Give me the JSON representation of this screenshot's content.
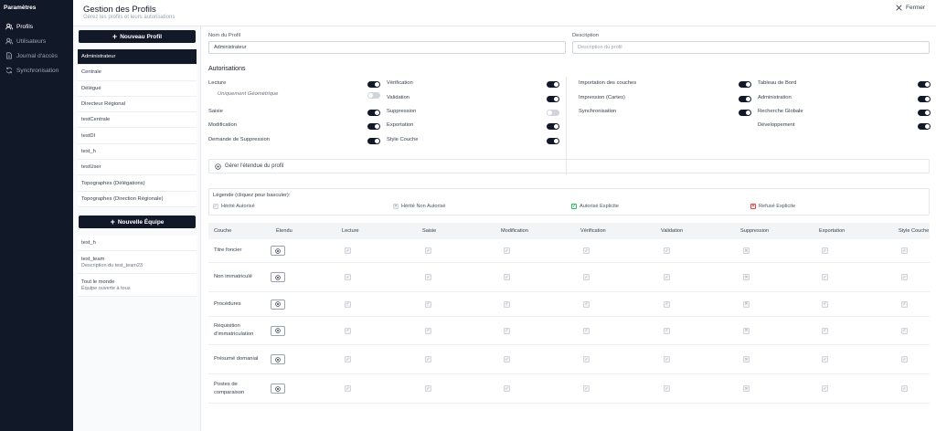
{
  "nav": {
    "title": "Paramètres",
    "items": [
      {
        "label": "Profils",
        "icon": "users-icon",
        "active": true
      },
      {
        "label": "Utilisateurs",
        "icon": "users-icon",
        "active": false
      },
      {
        "label": "Journal d'accès",
        "icon": "document-icon",
        "active": false
      },
      {
        "label": "Synchronisation",
        "icon": "sync-icon",
        "active": false
      }
    ]
  },
  "header": {
    "title": "Gestion des Profils",
    "subtitle": "Gérez les profils et leurs autorisations",
    "close_label": "Fermer"
  },
  "sidebar": {
    "new_profile_label": "Nouveau Profil",
    "profiles": [
      "Administrateur",
      "Centrale",
      "Délégué",
      "Directeur Régional",
      "testCentrale",
      "testDI",
      "test_h",
      "testUser",
      "Topographes (Délégations)",
      "Topographes (Direction Régionale)"
    ],
    "new_team_label": "Nouvelle Équipe",
    "teams": [
      {
        "name": "test_h",
        "description": ""
      },
      {
        "name": "test_team",
        "description": "Description du test_team23"
      },
      {
        "name": "Tout le monde",
        "description": "Équipe ouverte à tous"
      }
    ]
  },
  "form": {
    "profile_name_label": "Nom du Profil",
    "profile_name_value": "Administrateur",
    "description_label": "Description",
    "description_placeholder": "Description du profil"
  },
  "autorisations": {
    "title": "Autorisations",
    "col1": [
      {
        "label": "Lecture",
        "on": true
      },
      {
        "label": "Uniquement Géométrique",
        "on": false,
        "sub": true
      },
      {
        "label": "Saisie",
        "on": true
      },
      {
        "label": "Modification",
        "on": true
      },
      {
        "label": "Demande de Suppression",
        "on": true
      }
    ],
    "col2": [
      {
        "label": "Vérification",
        "on": true
      },
      {
        "label": "Validation",
        "on": true
      },
      {
        "label": "Suppression",
        "on": false
      },
      {
        "label": "Exportation",
        "on": true
      },
      {
        "label": "Style Couche",
        "on": true
      }
    ],
    "col3": [
      {
        "label": "Importation des couches",
        "on": true
      },
      {
        "label": "Impression (Cartes)",
        "on": true
      },
      {
        "label": "Synchronisation",
        "on": true
      }
    ],
    "col4": [
      {
        "label": "Tableau de Bord",
        "on": true
      },
      {
        "label": "Administration",
        "on": true
      },
      {
        "label": "Recherche Globale",
        "on": true
      },
      {
        "label": "Développement",
        "on": true
      }
    ]
  },
  "scope_button_label": "Gérer l'étendue du profil",
  "legend": {
    "title": "Légende (cliquez pour basculer):",
    "items": [
      {
        "label": "Hérité Autorisé",
        "mark": "✓",
        "color": "#f3f4f6",
        "border": "#d1d5db",
        "markColor": "#9ca3af"
      },
      {
        "label": "Hérité Non Autorisé",
        "mark": "✕",
        "color": "#f3f4f6",
        "border": "#d1d5db",
        "markColor": "#9ca3af"
      },
      {
        "label": "Autorisé Explicite",
        "mark": "✓",
        "color": "#ecfdf5",
        "border": "#22c55e",
        "markColor": "#16a34a"
      },
      {
        "label": "Refusé Explicite",
        "mark": "✕",
        "color": "#fef2f2",
        "border": "#ef4444",
        "markColor": "#dc2626"
      }
    ]
  },
  "table": {
    "headers": [
      "Couche",
      "Étendu",
      "Lecture",
      "Saisie",
      "Modification",
      "Vérification",
      "Validation",
      "Suppression",
      "Exportation",
      "Style Couche"
    ],
    "rows": [
      {
        "couche": "Titre foncier",
        "values": [
          "✓",
          "✓",
          "✓",
          "✓",
          "✓",
          "✕",
          "✓",
          "✓"
        ]
      },
      {
        "couche": "Non immatriculé",
        "values": [
          "✓",
          "✓",
          "✓",
          "✓",
          "✓",
          "✕",
          "✓",
          "✓"
        ]
      },
      {
        "couche": "Procédures",
        "values": [
          "✓",
          "✓",
          "✓",
          "✓",
          "✓",
          "✕",
          "✓",
          "✓"
        ]
      },
      {
        "couche": "Réquisition d'immatriculation",
        "values": [
          "✓",
          "✓",
          "✓",
          "✓",
          "✓",
          "✕",
          "✓",
          "✓"
        ]
      },
      {
        "couche": "Présumé domanial",
        "values": [
          "✓",
          "✓",
          "✓",
          "✓",
          "✓",
          "✕",
          "✓",
          "✓"
        ]
      },
      {
        "couche": "Postes de comparaison",
        "values": [
          "✓",
          "✓",
          "✓",
          "✓",
          "✓",
          "✕",
          "✓",
          "✓"
        ]
      }
    ]
  }
}
